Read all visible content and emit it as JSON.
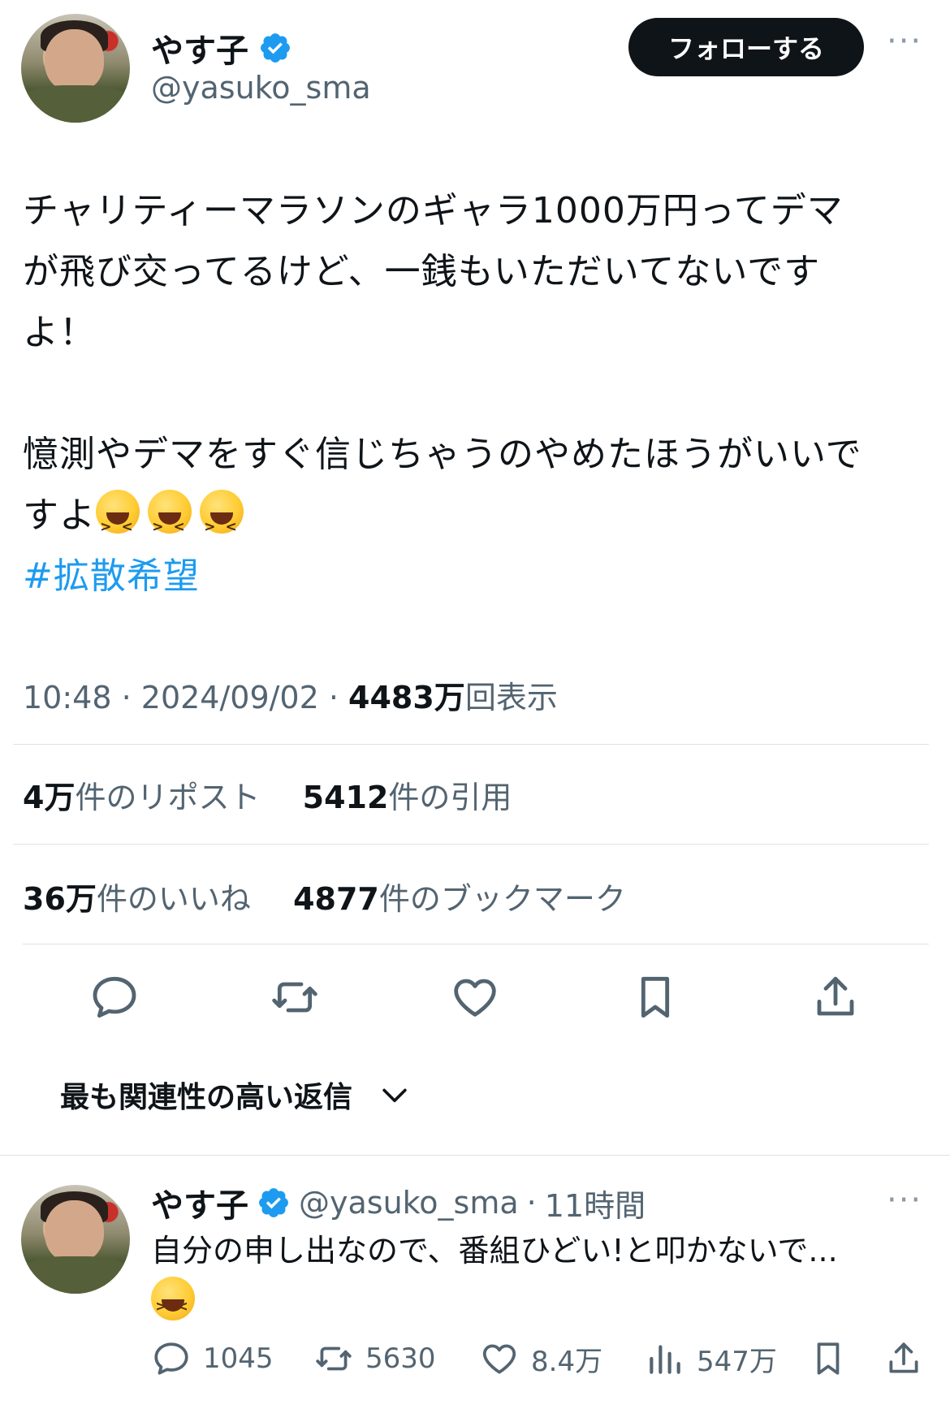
{
  "tweet": {
    "author_name": "やす子",
    "handle": "@yasuko_sma",
    "follow_label": "フォローする",
    "more_label": "···",
    "text_para1_line1": "チャリティーマラソンのギャラ1000万円ってデマ",
    "text_para1_line2": "が飛び交ってるけど、一銭もいただいてないです",
    "text_para1_line3": "よ！",
    "text_para2_line1": "憶測やデマをすぐ信じちゃうのやめたほうがいいで",
    "text_para2_line2": "すよ",
    "hashtag": "#拡散希望",
    "time": "10:48",
    "date": "2024/09/02",
    "views_count": "4483万",
    "views_label": "回表示",
    "reposts_count": "4万",
    "reposts_label": "件のリポスト",
    "quotes_count": "5412",
    "quotes_label": "件の引用",
    "likes_count": "36万",
    "likes_label": "件のいいね",
    "bookmarks_count": "4877",
    "bookmarks_label": "件のブックマーク"
  },
  "sort": {
    "label": "最も関連性の高い返信"
  },
  "reply": {
    "author_name": "やす子",
    "handle": "@yasuko_sma",
    "time": "11時間",
    "text": "自分の申し出なので、番組ひどい!と叩かないで...",
    "replies": "1045",
    "retweets": "5630",
    "likes": "8.4万",
    "views": "547万"
  },
  "colors": {
    "link": "#1d9bf0",
    "verified": "#1d9bf0",
    "secondary_text": "#536471"
  }
}
